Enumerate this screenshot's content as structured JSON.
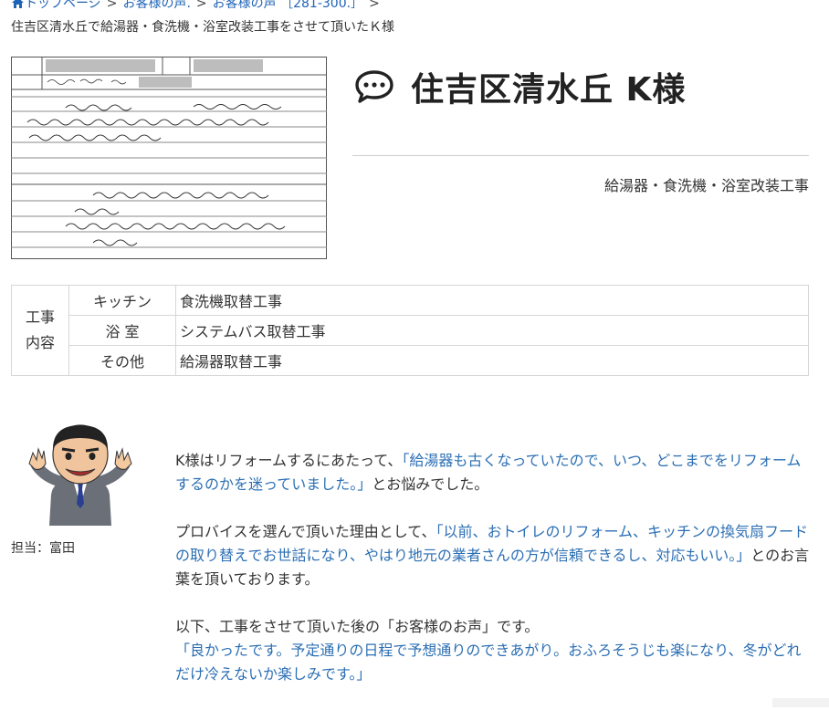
{
  "breadcrumb": {
    "home_label": "トップページ",
    "sep": ">",
    "item2": "お客様の声.",
    "item3": "お客様の声 ［281-300.］"
  },
  "page_subtitle": "住吉区清水丘で給湯器・食洗機・浴室改装工事をさせて頂いたＫ様",
  "header": {
    "title": "住吉区清水丘 K様",
    "meta": "給湯器・食洗機・浴室改装工事"
  },
  "work": {
    "head_line1": "工事",
    "head_line2": "内容",
    "rows": [
      {
        "category": "キッチン",
        "detail": "食洗機取替工事"
      },
      {
        "category": "浴 室",
        "detail": "システムバス取替工事"
      },
      {
        "category": "その他",
        "detail": "給湯器取替工事"
      }
    ]
  },
  "staff": {
    "label": "担当：富田"
  },
  "body": {
    "p1_a": "K様はリフォームするにあたって、",
    "p1_quote": "「給湯器も古くなっていたので、いつ、どこまでをリフォームするのかを迷っていました。」",
    "p1_b": "とお悩みでした。",
    "p2_a": "プロバイスを選んで頂いた理由として、",
    "p2_quote": "「以前、おトイレのリフォーム、キッチンの換気扇フードの取り替えでお世話になり、やはり地元の業者さんの方が信頼できるし、対応もいい。」",
    "p2_b": "とのお言葉を頂いております。",
    "p3_a": "以下、工事をさせて頂いた後の「お客様のお声」です。",
    "p3_quote": "「良かったです。予定通りの日程で予想通りのできあがり。おふろそうじも楽になり、冬がどれだけ冷えないか楽しみです。」"
  },
  "colors": {
    "link": "#1f63b6",
    "highlight": "#2c6fb4",
    "text": "#333333"
  }
}
